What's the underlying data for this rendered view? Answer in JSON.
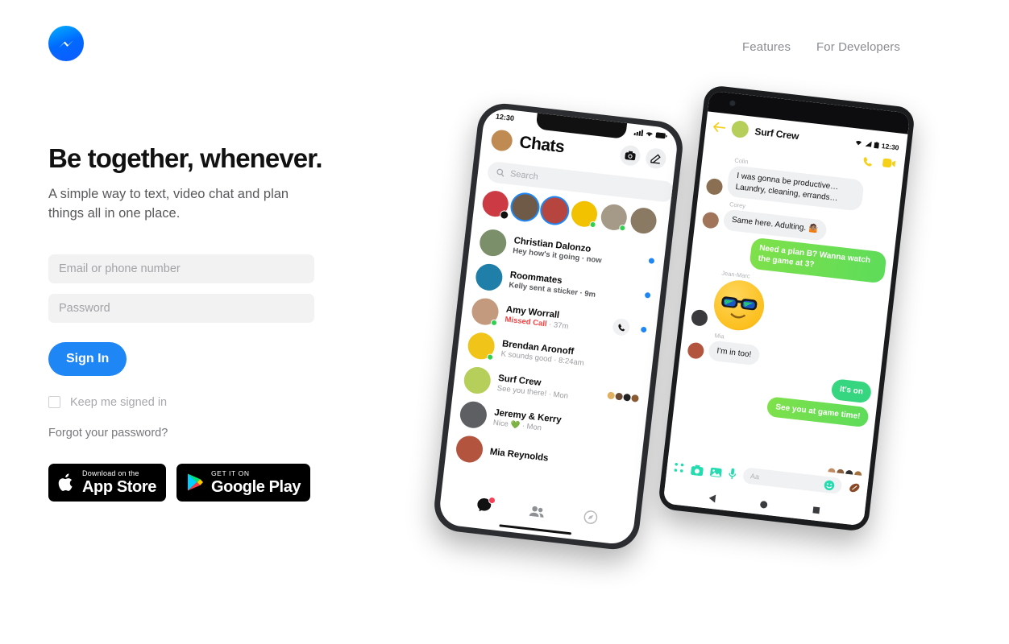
{
  "header": {
    "logo_icon": "messenger-logo",
    "nav": [
      {
        "label": "Features"
      },
      {
        "label": "For Developers"
      }
    ]
  },
  "hero": {
    "headline": "Be together, whenever.",
    "subheading": "A simple way to text, video chat and plan things all in one place."
  },
  "login": {
    "email_placeholder": "Email or phone number",
    "email_value": "",
    "password_placeholder": "Password",
    "password_value": "",
    "signin_label": "Sign In",
    "keep_signed_in_label": "Keep me signed in",
    "keep_signed_in_checked": false,
    "forgot_label": "Forgot your password?",
    "accent_color": "#1f87f5"
  },
  "store_badges": [
    {
      "small": "Download on the",
      "big": "App Store",
      "icon": "apple-icon"
    },
    {
      "small": "GET IT ON",
      "big": "Google Play",
      "icon": "google-play-icon"
    }
  ],
  "iphone": {
    "status_time": "12:30",
    "title": "Chats",
    "search_placeholder": "Search",
    "actions": [
      {
        "icon": "camera-icon"
      },
      {
        "icon": "compose-icon"
      }
    ],
    "stories": [
      {
        "color": "#cc3a44",
        "ring": false,
        "camera": true,
        "online": false
      },
      {
        "color": "#6f5a48",
        "ring": true,
        "camera": false,
        "online": false
      },
      {
        "color": "#b5453e",
        "ring": true,
        "camera": false,
        "online": false
      },
      {
        "color": "#f2c200",
        "ring": false,
        "camera": false,
        "online": true
      },
      {
        "color": "#a59a88",
        "ring": false,
        "camera": false,
        "online": true
      },
      {
        "color": "#8a7a63",
        "ring": false,
        "camera": false,
        "online": false
      }
    ],
    "chats": [
      {
        "name": "Christian Dalonzo",
        "preview": "Hey how's it going",
        "time": "now",
        "color": "#7b8f6b",
        "unread": true,
        "online": false,
        "right": "dot"
      },
      {
        "name": "Roommates",
        "preview": "Kelly sent a sticker",
        "time": "9m",
        "color": "#1f7fa8",
        "unread": true,
        "online": false,
        "right": "dot"
      },
      {
        "name": "Amy Worrall",
        "preview": "Missed Call",
        "time": "37m",
        "color": "#c39a7d",
        "unread": false,
        "online": true,
        "right": "call",
        "missed": true
      },
      {
        "name": "Brendan Aronoff",
        "preview": "K sounds good",
        "time": "8:24am",
        "color": "#f0c419",
        "unread": false,
        "online": true,
        "right": "none"
      },
      {
        "name": "Surf Crew",
        "preview": "See you there!",
        "time": "Mon",
        "color": "#b6cf5a",
        "unread": false,
        "online": false,
        "right": "seen"
      },
      {
        "name": "Jeremy & Kerry",
        "preview": "Nice 💚",
        "time": "Mon",
        "color": "#5d5f63",
        "unread": false,
        "online": false,
        "right": "none"
      },
      {
        "name": "Mia Reynolds",
        "preview": "",
        "time": "",
        "color": "#b3543f",
        "unread": false,
        "online": false,
        "right": "none"
      }
    ],
    "tabs": [
      {
        "icon": "chats-tab-icon",
        "badge": true
      },
      {
        "icon": "people-tab-icon",
        "badge": false
      },
      {
        "icon": "discover-tab-icon",
        "badge": false
      }
    ]
  },
  "android": {
    "status_time": "12:30",
    "title": "Surf Crew",
    "back_icon": "back-arrow-icon",
    "actions": [
      {
        "icon": "phone-call-icon"
      },
      {
        "icon": "video-call-icon"
      }
    ],
    "messages": [
      {
        "sender": "Colin",
        "text": "I was gonna be productive… Laundry, cleaning, errands…",
        "out": false,
        "avatar": "#8a6f52"
      },
      {
        "sender": "Corey",
        "text": "Same here. Adulting. 🤷🏽",
        "out": false,
        "avatar": "#a0755a"
      },
      {
        "sender": "",
        "text": "Need a plan B? Wanna watch the game at 3?",
        "out": true
      },
      {
        "sender": "Jean-Marc",
        "text": "",
        "out": false,
        "avatar": "#3a3a3c",
        "sticker": "sunglasses-emoji"
      },
      {
        "sender": "Mia",
        "text": "I'm in too!",
        "out": false,
        "avatar": "#b3543f"
      },
      {
        "sender": "",
        "text": "It's on",
        "out": true
      },
      {
        "sender": "",
        "text": "See you at game time!",
        "out": true
      }
    ],
    "seen_avatars": [
      "#c08a63",
      "#8b5e3c",
      "#2e2e30",
      "#a4713f"
    ],
    "input_placeholder": "Aa",
    "input_actions": [
      {
        "icon": "apps-grid-icon"
      },
      {
        "icon": "camera-icon"
      },
      {
        "icon": "gallery-icon"
      },
      {
        "icon": "microphone-icon"
      }
    ],
    "emoji_icon": "smiley-icon",
    "sticker_icon": "football-sticker-icon",
    "nav": [
      {
        "icon": "android-back-icon"
      },
      {
        "icon": "android-home-icon"
      },
      {
        "icon": "android-recents-icon"
      }
    ]
  }
}
